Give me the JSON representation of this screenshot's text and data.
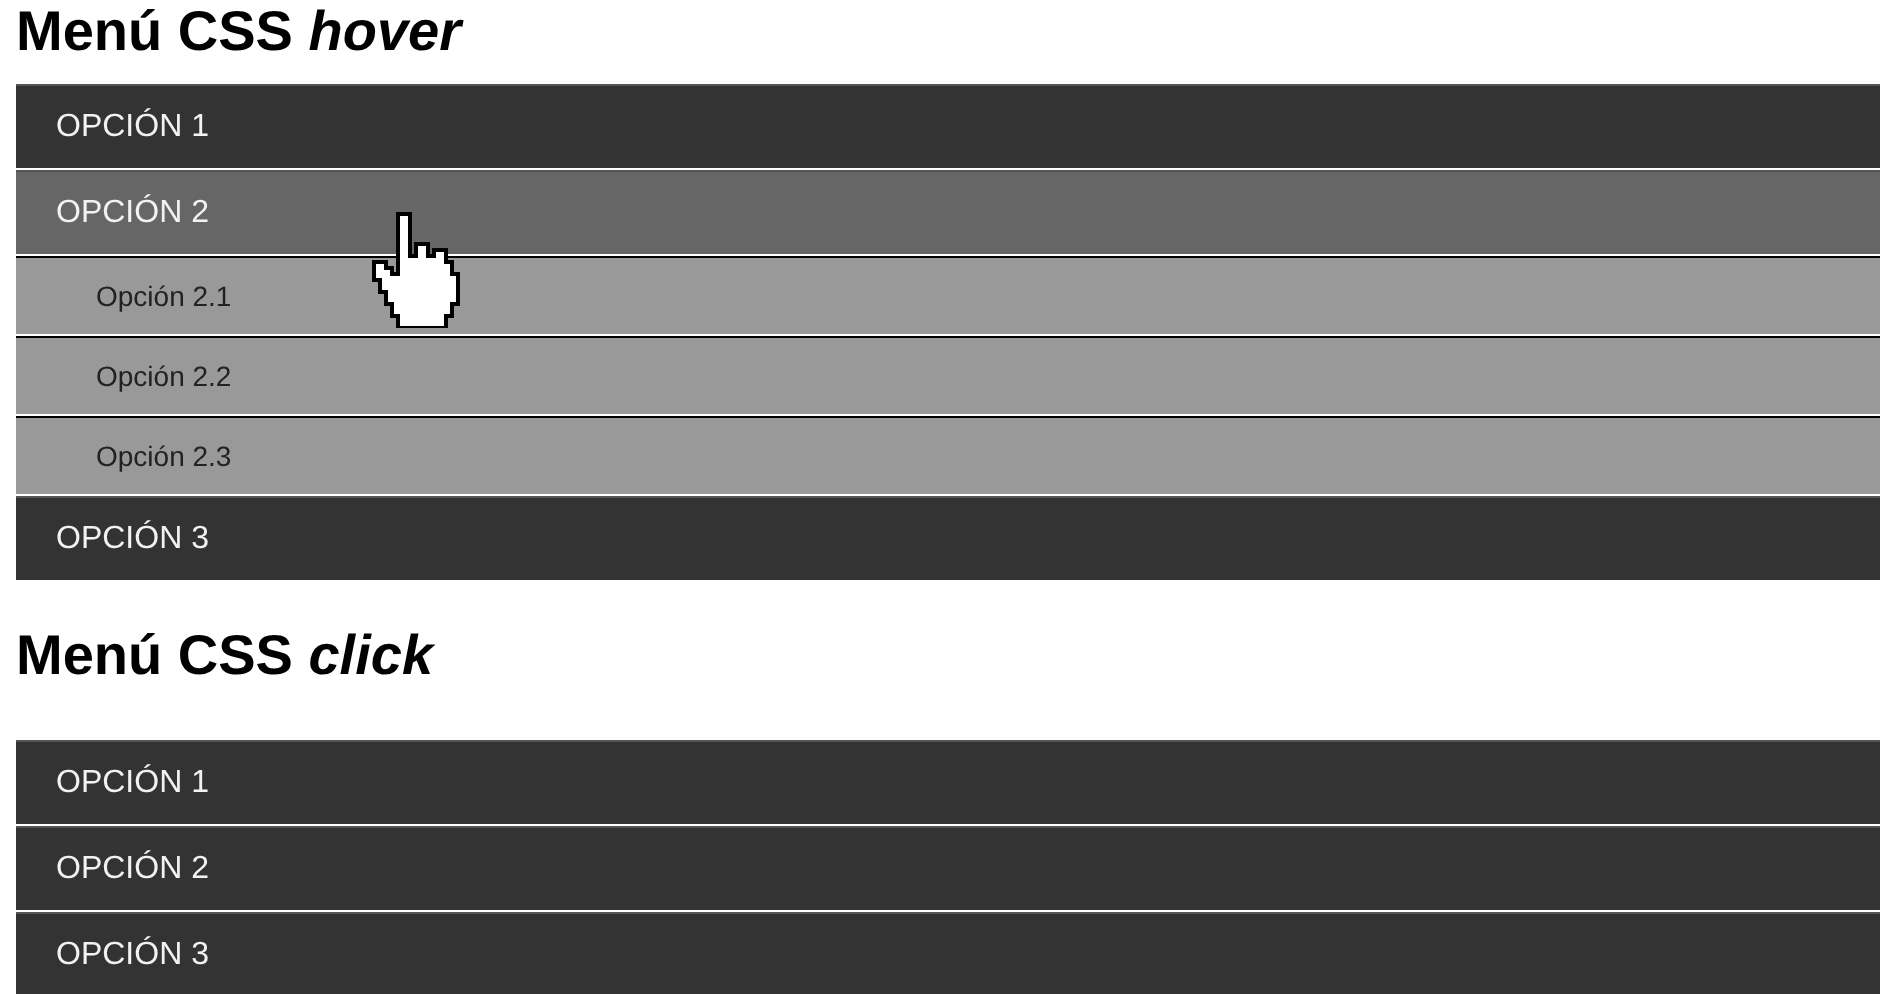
{
  "hover_menu": {
    "title": "Menú CSS *hover*",
    "items": [
      {
        "label": "OPCIÓN 1",
        "hovered": false
      },
      {
        "label": "OPCIÓN 2",
        "hovered": true,
        "children": [
          {
            "label": "Opción 2.1"
          },
          {
            "label": "Opción 2.2"
          },
          {
            "label": "Opción 2.3"
          }
        ]
      },
      {
        "label": "OPCIÓN 3",
        "hovered": false
      }
    ]
  },
  "click_menu": {
    "title": "Menú CSS *click*",
    "items": [
      {
        "label": "OPCIÓN 1",
        "hovered": false
      },
      {
        "label": "OPCIÓN 2",
        "hovered": false
      },
      {
        "label": "OPCIÓN 3",
        "hovered": false
      }
    ]
  }
}
